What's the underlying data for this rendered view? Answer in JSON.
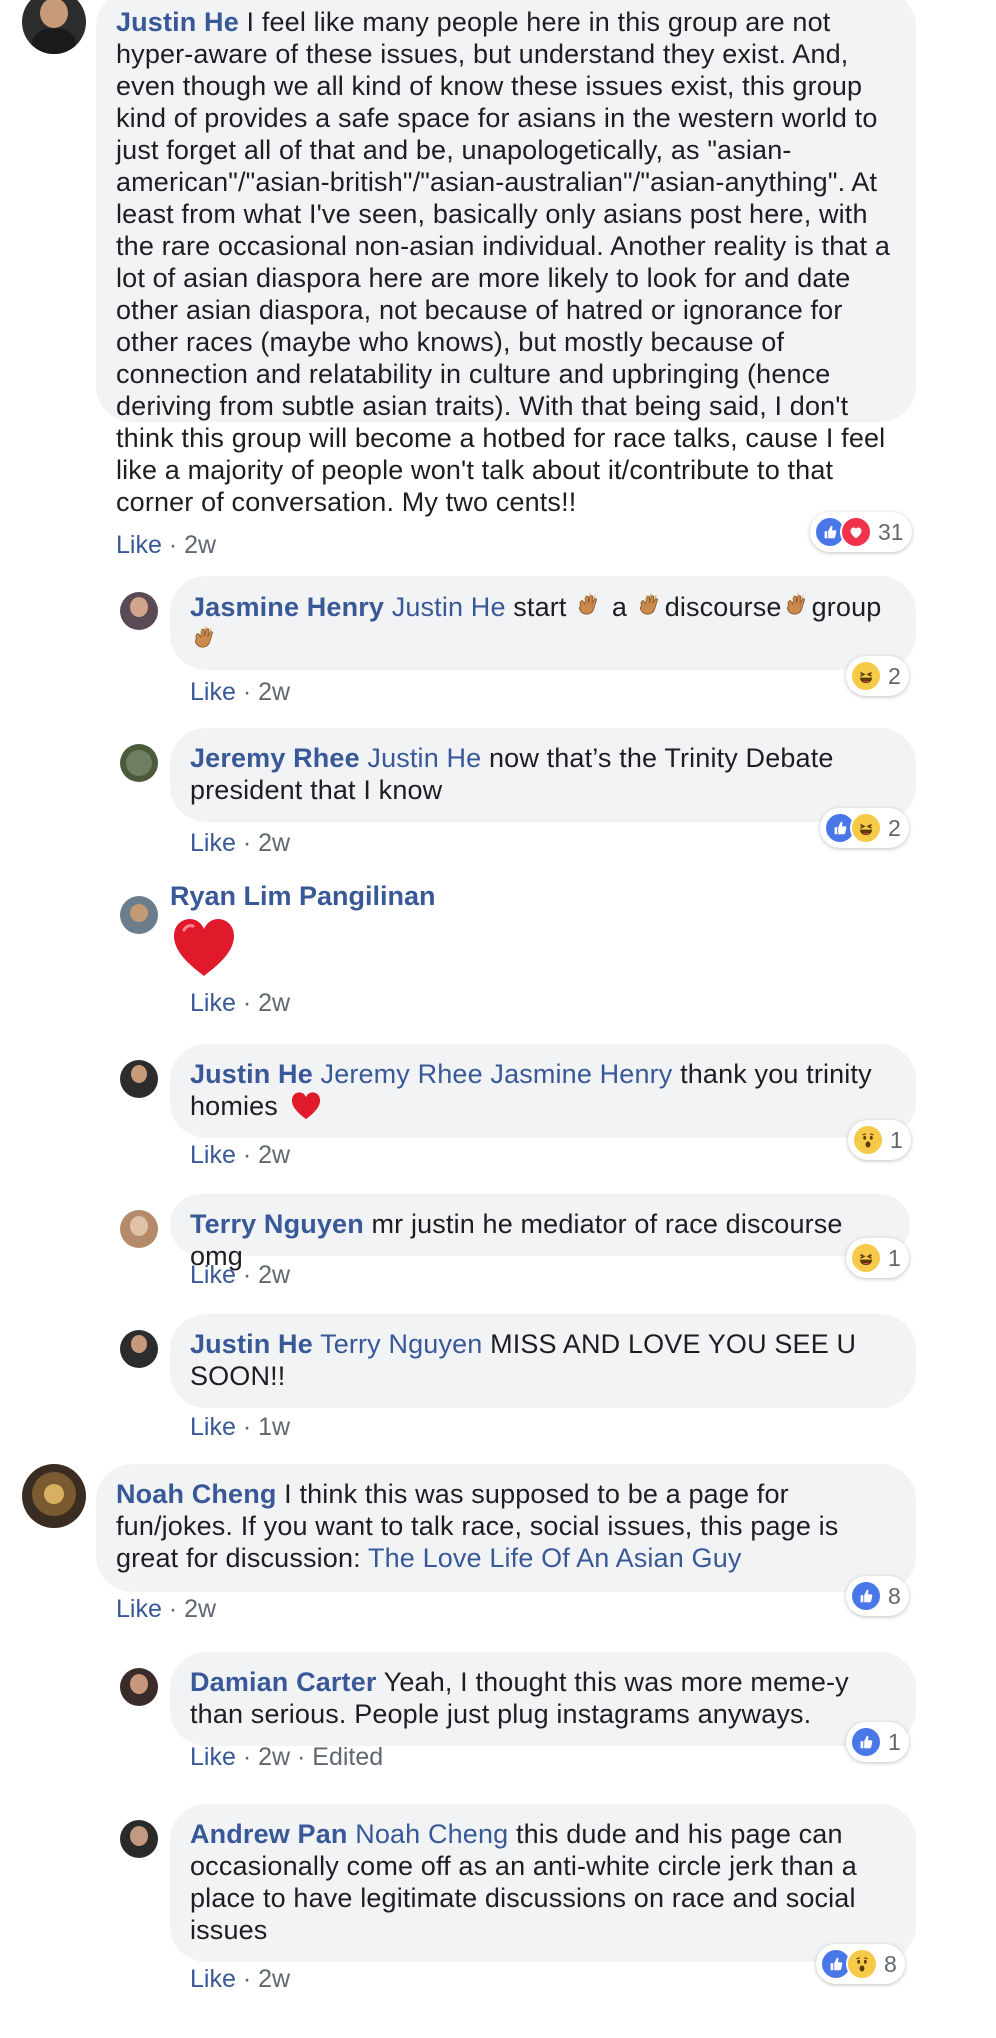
{
  "comments": [
    {
      "author": "Justin He",
      "text": "I feel like many people here in this group are not hyper-aware of these issues, but understand they exist. And, even though we all kind of know these issues exist, this group kind of provides a safe space for asians in the western world to just forget all of that and be, unapologetically, as \"asian-american\"/\"asian-british\"/\"asian-australian\"/\"asian-anything\". At least from what I've seen, basically only asians post here, with the rare occasional non-asian individual. Another reality is that a lot of asian diaspora here are more likely to look for and date other asian diaspora, not because of hatred or ignorance for other races (maybe who knows), but mostly because of connection and relatability in culture and upbringing (hence deriving from subtle asian traits). With that being said, I don't think this group will become a hotbed for race talks, cause I feel like a majority of people won't talk about it/contribute to that corner of conversation. My two cents!!",
      "like": "Like",
      "time": "2w",
      "reaction_count": "31",
      "reactions": [
        "like",
        "love"
      ]
    },
    {
      "author": "Jasmine Henry",
      "tag": "Justin He",
      "w1": "start",
      "w2": "a",
      "w3": "discourse",
      "w4": "group",
      "like": "Like",
      "time": "2w",
      "reaction_count": "2",
      "reactions": [
        "haha"
      ]
    },
    {
      "author": "Jeremy Rhee",
      "tag": "Justin He",
      "text": "now that’s the Trinity Debate president that I know",
      "like": "Like",
      "time": "2w",
      "reaction_count": "2",
      "reactions": [
        "like",
        "haha"
      ]
    },
    {
      "author": "Ryan Lim Pangilinan",
      "like": "Like",
      "time": "2w"
    },
    {
      "author": "Justin He",
      "tags": [
        "Jeremy Rhee",
        "Jasmine Henry"
      ],
      "text": "thank you trinity homies",
      "like": "Like",
      "time": "2w",
      "reaction_count": "1",
      "reactions": [
        "wow"
      ]
    },
    {
      "author": "Terry Nguyen",
      "text": "mr justin he mediator of race discourse omg",
      "like": "Like",
      "time": "2w",
      "reaction_count": "1",
      "reactions": [
        "haha"
      ]
    },
    {
      "author": "Justin He",
      "tag": "Terry Nguyen",
      "text": "MISS AND LOVE YOU SEE U SOON!!",
      "like": "Like",
      "time": "1w"
    },
    {
      "author": "Noah Cheng",
      "text": "I think this was supposed to be a page for fun/jokes. If you want to talk race, social issues, this page is great for discussion:",
      "link": "The Love Life Of An Asian Guy",
      "like": "Like",
      "time": "2w",
      "reaction_count": "8",
      "reactions": [
        "like"
      ]
    },
    {
      "author": "Damian Carter",
      "text": "Yeah, I thought this was more meme-y than serious. People just plug instagrams anyways.",
      "like": "Like",
      "time": "2w",
      "edited": "Edited",
      "reaction_count": "1",
      "reactions": [
        "like"
      ]
    },
    {
      "author": "Andrew Pan",
      "tag": "Noah Cheng",
      "text": "this dude and his page can occasionally come off as an anti-white circle jerk than a place to have legitimate discussions on race and social issues",
      "like": "Like",
      "time": "2w",
      "reaction_count": "8",
      "reactions": [
        "like",
        "wow"
      ]
    }
  ],
  "colors": {
    "bubble": "#f2f3f5",
    "name": "#385898",
    "meta": "#606770",
    "like_reaction": "#4a77e8",
    "love_reaction": "#f0324c",
    "heart": "#e0192b"
  }
}
